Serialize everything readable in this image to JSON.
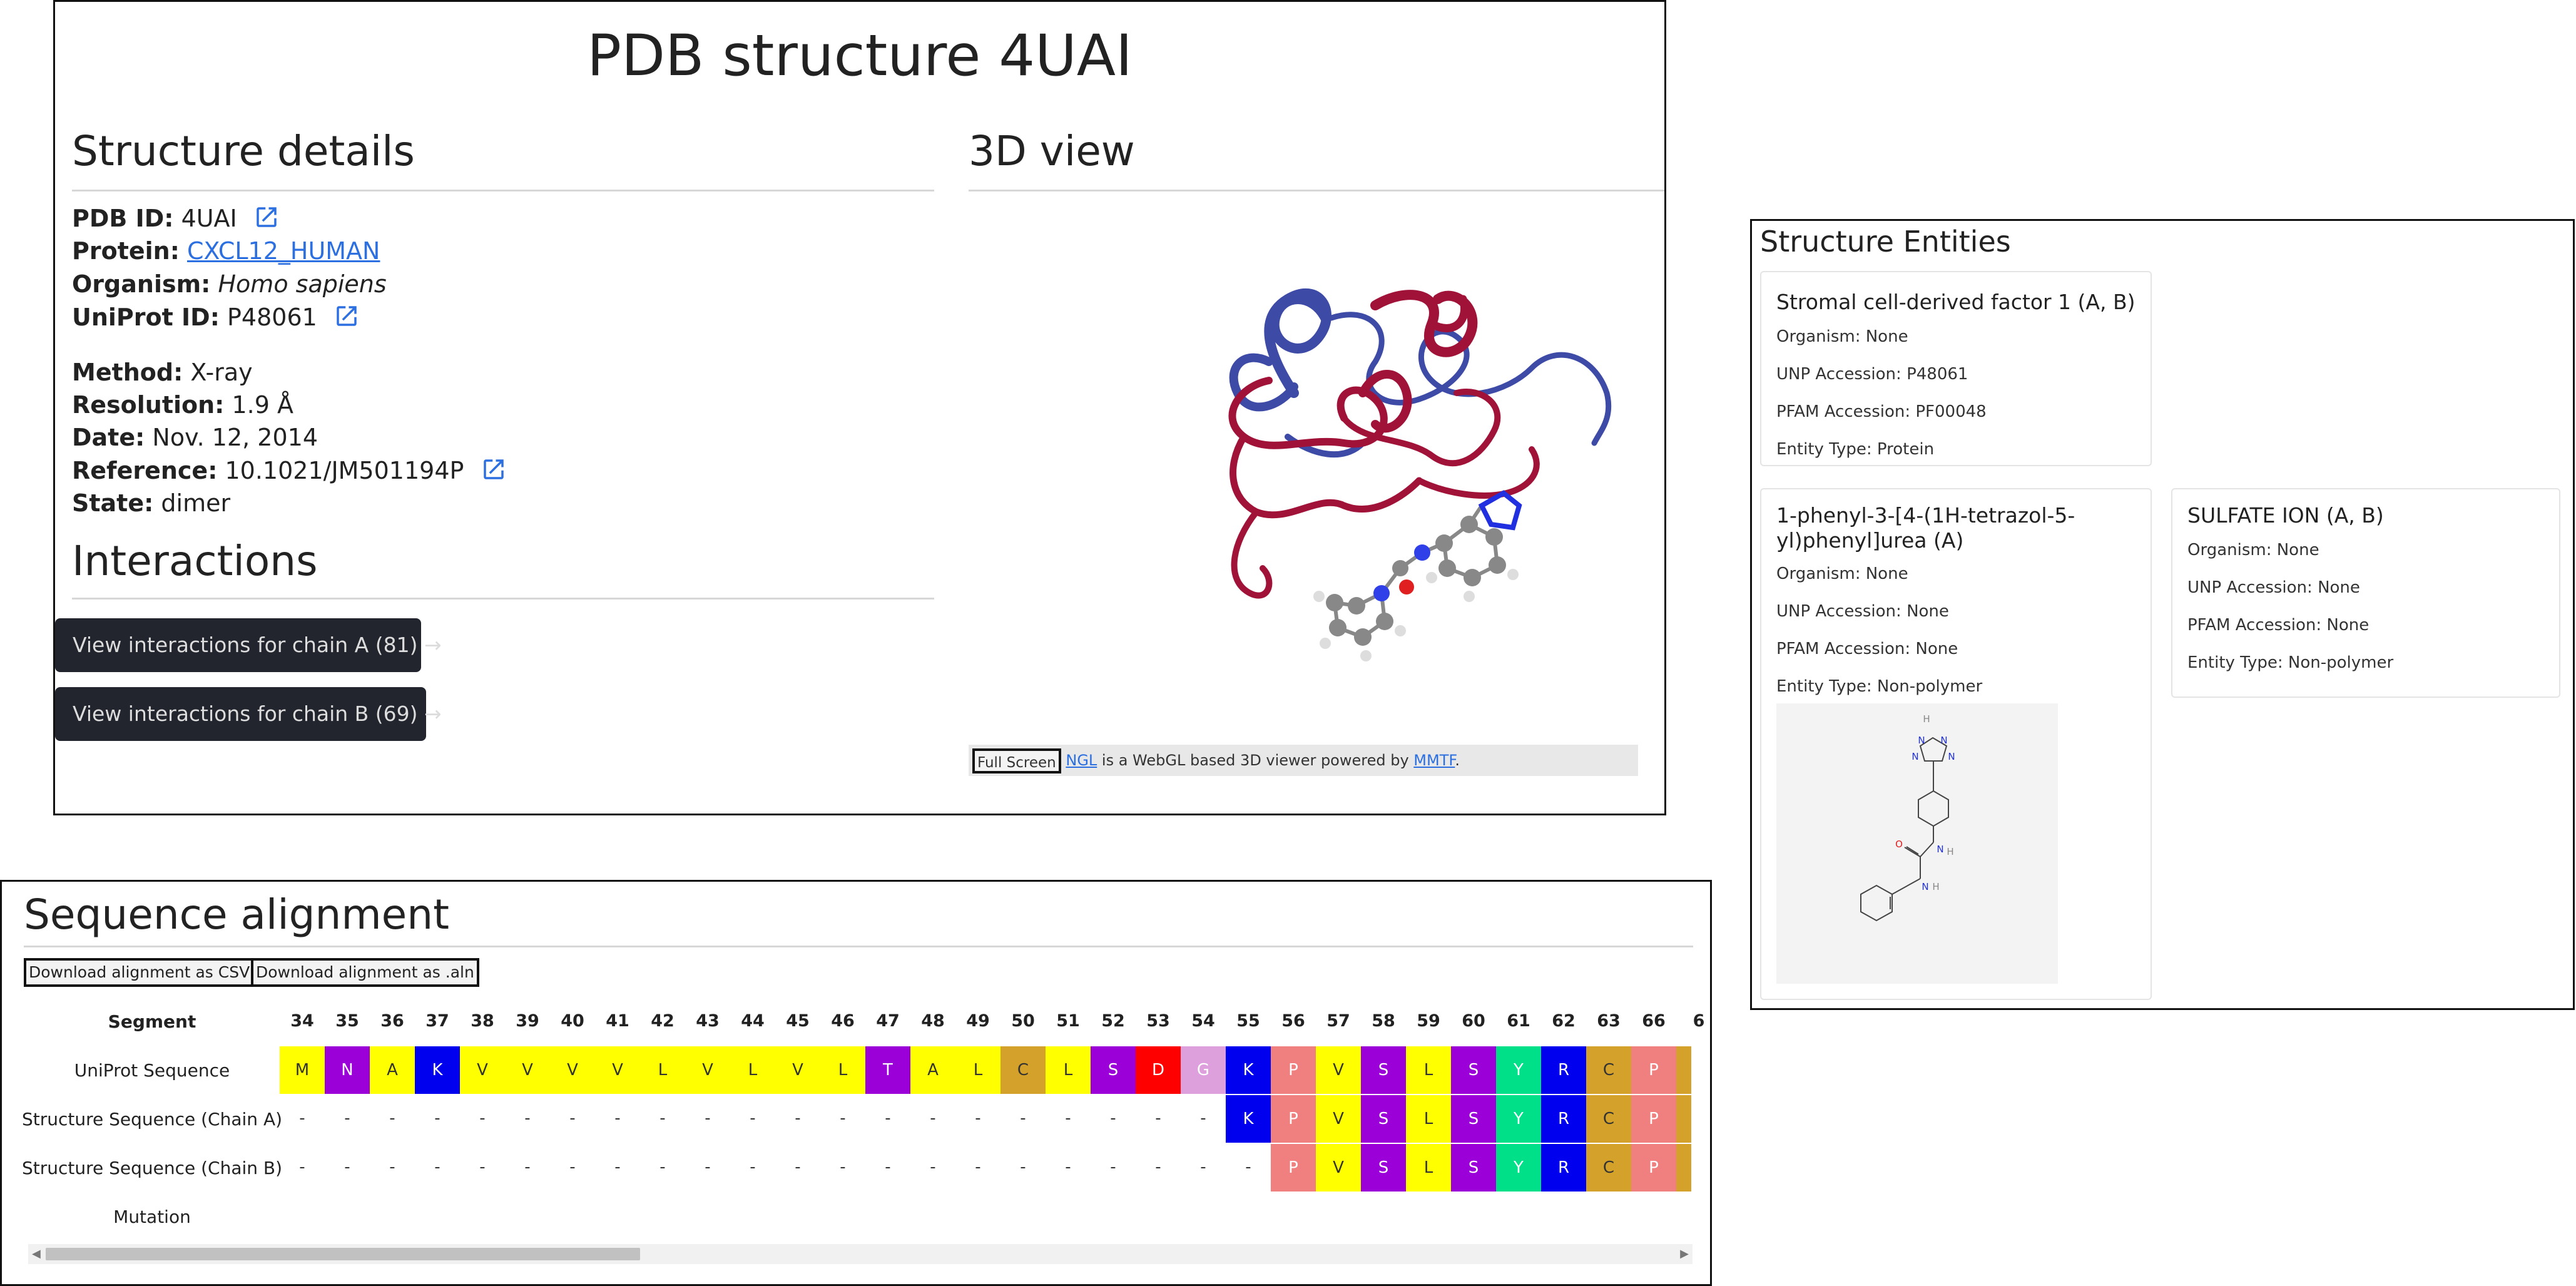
{
  "pdb_panel": {
    "title": "PDB structure 4UAI",
    "structure_details_title": "Structure details",
    "view3d_title": "3D view",
    "details": {
      "pdb_id_label": "PDB ID:",
      "pdb_id_value": "4UAI",
      "protein_label": "Protein:",
      "protein_value": "CXCL12_HUMAN",
      "organism_label": "Organism:",
      "organism_value": "Homo sapiens",
      "uniprot_label": "UniProt ID:",
      "uniprot_value": "P48061",
      "method_label": "Method:",
      "method_value": "X-ray",
      "resolution_label": "Resolution:",
      "resolution_value": "1.9 Å",
      "date_label": "Date:",
      "date_value": "Nov. 12, 2014",
      "reference_label": "Reference:",
      "reference_value": "10.1021/JM501194P",
      "state_label": "State:",
      "state_value": "dimer"
    },
    "interactions_title": "Interactions",
    "interaction_buttons": [
      "View interactions for chain A (81) →",
      "View interactions for chain B (69) →"
    ],
    "viewer_bar": {
      "fullscreen": "Full Screen",
      "ngl_link": "NGL",
      "text_mid": " is a WebGL based 3D viewer powered by ",
      "mmtf_link": "MMTF",
      "text_end": "."
    }
  },
  "entities_panel": {
    "title": "Structure Entities",
    "cards": [
      {
        "title": "Stromal cell-derived factor 1 (A, B)",
        "organism": "Organism: None",
        "unp": "UNP Accession: P48061",
        "pfam": "PFAM Accession: PF00048",
        "type": "Entity Type: Protein"
      },
      {
        "title": "1-phenyl-3-[4-(1H-tetrazol-5-yl)phenyl]urea (A)",
        "organism": "Organism: None",
        "unp": "UNP Accession: None",
        "pfam": "PFAM Accession: None",
        "type": "Entity Type: Non-polymer"
      },
      {
        "title": "SULFATE ION (A, B)",
        "organism": "Organism: None",
        "unp": "UNP Accession: None",
        "pfam": "PFAM Accession: None",
        "type": "Entity Type: Non-polymer"
      }
    ],
    "molecule_atoms": {
      "nitrogen": "N",
      "hydrogen": "H",
      "oxygen": "O"
    }
  },
  "sequence_panel": {
    "title": "Sequence alignment",
    "download_csv": "Download alignment as CSV",
    "download_aln": "Download alignment as .aln",
    "row_labels": [
      "Segment",
      "UniProt Sequence",
      "Structure Sequence (Chain A)",
      "Structure Sequence (Chain B)",
      "Mutation"
    ],
    "positions": [
      "34",
      "35",
      "36",
      "37",
      "38",
      "39",
      "40",
      "41",
      "42",
      "43",
      "44",
      "45",
      "46",
      "47",
      "48",
      "49",
      "50",
      "51",
      "52",
      "53",
      "54",
      "55",
      "56",
      "57",
      "58",
      "59",
      "60",
      "61",
      "62",
      "63",
      "66",
      "6"
    ],
    "uniprot": [
      "M",
      "N",
      "A",
      "K",
      "V",
      "V",
      "V",
      "V",
      "L",
      "V",
      "L",
      "V",
      "L",
      "T",
      "A",
      "L",
      "C",
      "L",
      "S",
      "D",
      "G",
      "K",
      "P",
      "V",
      "S",
      "L",
      "S",
      "Y",
      "R",
      "C",
      "P",
      ""
    ],
    "chain_a": [
      "-",
      "-",
      "-",
      "-",
      "-",
      "-",
      "-",
      "-",
      "-",
      "-",
      "-",
      "-",
      "-",
      "-",
      "-",
      "-",
      "-",
      "-",
      "-",
      "-",
      "-",
      "K",
      "P",
      "V",
      "S",
      "L",
      "S",
      "Y",
      "R",
      "C",
      "P",
      ""
    ],
    "chain_b": [
      "-",
      "-",
      "-",
      "-",
      "-",
      "-",
      "-",
      "-",
      "-",
      "-",
      "-",
      "-",
      "-",
      "-",
      "-",
      "-",
      "-",
      "-",
      "-",
      "-",
      "-",
      "-",
      "P",
      "V",
      "S",
      "L",
      "S",
      "Y",
      "R",
      "C",
      "P",
      ""
    ],
    "residue_colors": {
      "A": "#ffff00",
      "V": "#ffff00",
      "L": "#ffff00",
      "M": "#ffff00",
      "N": "#9b00d9",
      "K": "#0000ee",
      "T": "#9b00d9",
      "S": "#9b00d9",
      "C": "#d4a12a",
      "D": "#ff0000",
      "G": "#dda0dd",
      "P": "#f08080",
      "Y": "#00e088",
      "R": "#0000ee"
    }
  }
}
